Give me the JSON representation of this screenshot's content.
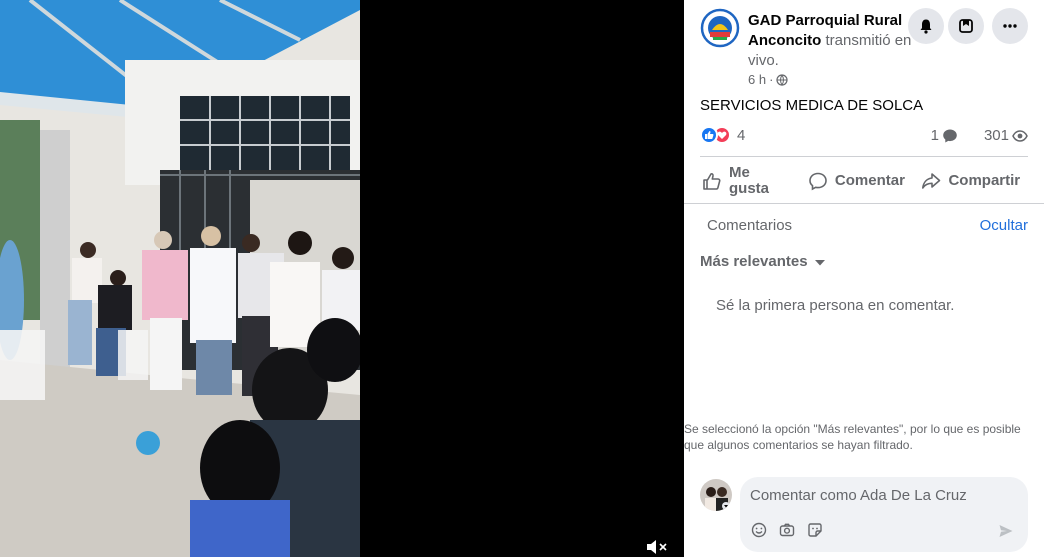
{
  "post": {
    "page_name": "GAD Parroquial Rural Anconcito",
    "verb": "transmitió en vivo.",
    "time": "6 h",
    "text": "SERVICIOS MEDICA DE SOLCA",
    "reaction_count": "4",
    "comment_count": "1",
    "view_count": "301"
  },
  "actions": {
    "like": "Me gusta",
    "comment": "Comentar",
    "share": "Compartir"
  },
  "comments": {
    "heading": "Comentarios",
    "hide": "Ocultar",
    "sort": "Más relevantes",
    "empty": "Sé la primera persona en comentar.",
    "filter_note": "Se seleccionó la opción \"Más relevantes\", por lo que es posible que algunos comentarios se hayan filtrado.",
    "composer_placeholder": "Comentar como Ada De La Cruz"
  },
  "icons": {
    "notifications": "bell-icon",
    "save": "bookmark-box-icon",
    "more": "more-dots-icon",
    "audience": "globe-icon",
    "like_reaction": "thumbs-up-icon",
    "love_reaction": "heart-icon",
    "comment_bubble": "comment-icon",
    "views": "eye-icon",
    "emoji": "emoji-icon",
    "camera": "camera-icon",
    "sticker": "sticker-icon",
    "send": "send-icon",
    "volume": "muted-speaker-icon"
  },
  "colors": {
    "link_blue": "#216fdb",
    "like_blue": "#1877f2",
    "love_red": "#f33e58",
    "secondary_text": "#65676b"
  }
}
